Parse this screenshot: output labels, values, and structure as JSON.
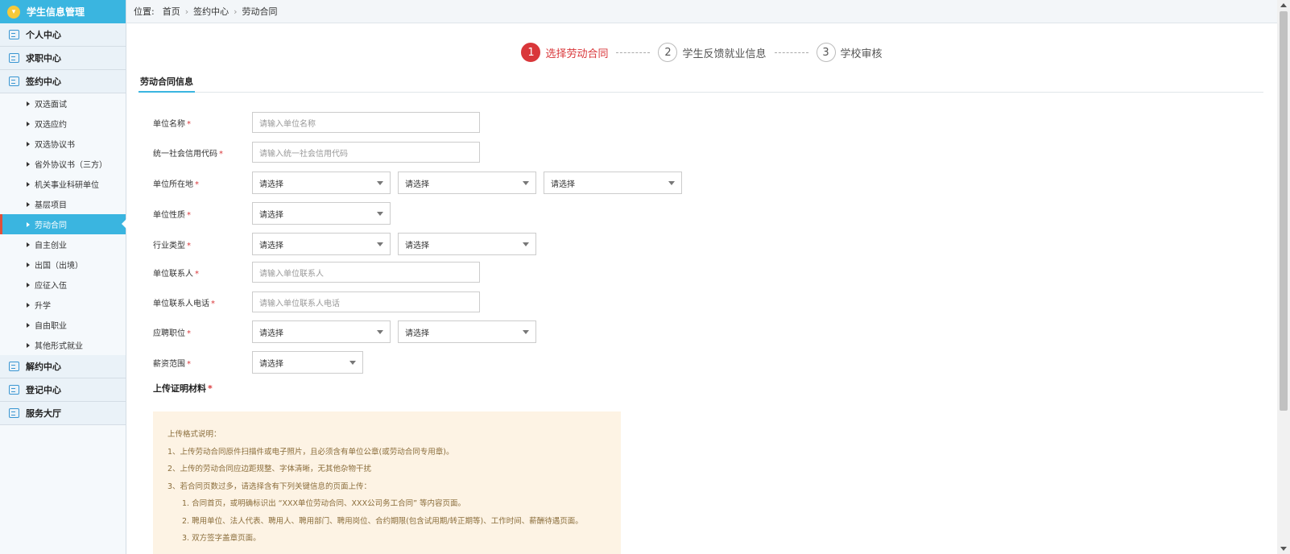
{
  "sidebar": {
    "header": "学生信息管理",
    "groups_top": [
      "个人中心",
      "求职中心",
      "签约中心"
    ],
    "sub_items": [
      "双选面试",
      "双选应约",
      "双选协议书",
      "省外协议书（三方）",
      "机关事业科研单位",
      "基层项目",
      "劳动合同",
      "自主创业",
      "出国（出境）",
      "应征入伍",
      "升学",
      "自由职业",
      "其他形式就业"
    ],
    "active_sub": "劳动合同",
    "groups_bottom": [
      "解约中心",
      "登记中心",
      "服务大厅"
    ]
  },
  "breadcrumb": {
    "prefix": "位置:",
    "items": [
      "首页",
      "签约中心",
      "劳动合同"
    ]
  },
  "steps": [
    {
      "num": "1",
      "label": "选择劳动合同"
    },
    {
      "num": "2",
      "label": "学生反馈就业信息"
    },
    {
      "num": "3",
      "label": "学校审核"
    }
  ],
  "section_title": "劳动合同信息",
  "form": {
    "unit_name": {
      "label": "单位名称",
      "placeholder": "请输入单位名称"
    },
    "credit_code": {
      "label": "统一社会信用代码",
      "placeholder": "请输入统一社会信用代码"
    },
    "location": {
      "label": "单位所在地",
      "options": [
        "请选择",
        "请选择",
        "请选择"
      ]
    },
    "nature": {
      "label": "单位性质",
      "options": [
        "请选择"
      ]
    },
    "industry": {
      "label": "行业类型",
      "options": [
        "请选择",
        "请选择"
      ]
    },
    "contact": {
      "label": "单位联系人",
      "placeholder": "请输入单位联系人"
    },
    "contact_phone": {
      "label": "单位联系人电话",
      "placeholder": "请输入单位联系人电话"
    },
    "position": {
      "label": "应聘职位",
      "options": [
        "请选择",
        "请选择"
      ]
    },
    "salary": {
      "label": "薪资范围",
      "options": [
        "请选择"
      ]
    },
    "required_mark": "*"
  },
  "upload": {
    "title": "上传证明材料",
    "note_lines": [
      "上传格式说明：",
      "1、上传劳动合同原件扫描件或电子照片，且必须含有单位公章(或劳动合同专用章)。",
      "2、上传的劳动合同应边距规整、字体清晰，无其他杂物干扰",
      "3、若合同页数过多，请选择含有下列关键信息的页面上传：",
      "1. 合同首页，或明确标识出 “XXX单位劳动合同、XXX公司务工合同” 等内容页面。",
      "2. 聘用单位、法人代表、聘用人、聘用部门、聘用岗位、合约期限(包含试用期/转正期等)、工作时间、薪酬待遇页面。",
      "3. 双方签字盖章页面。"
    ]
  },
  "colors": {
    "accent": "#3ab5e0",
    "step_active": "#d9373a",
    "note_bg": "#fdf3e4"
  }
}
